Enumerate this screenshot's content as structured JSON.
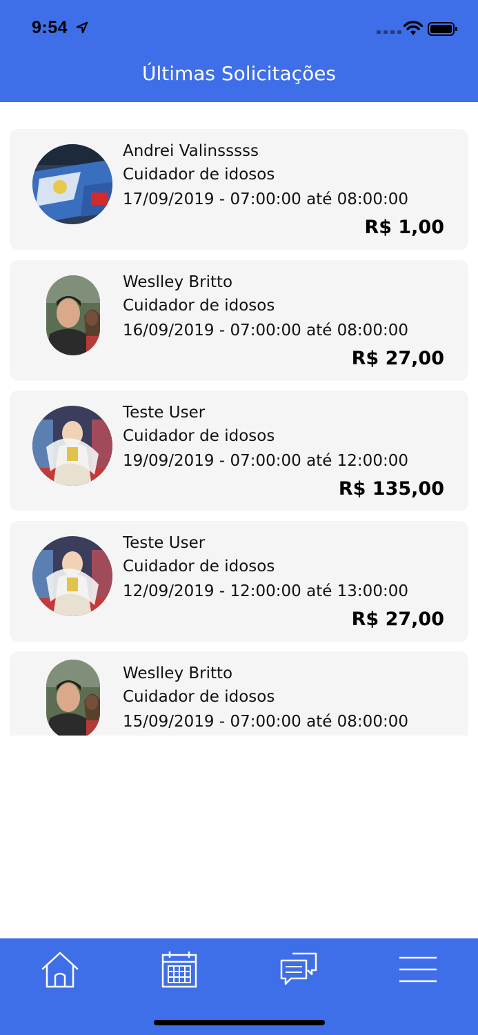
{
  "status_bar": {
    "time": "9:54"
  },
  "header": {
    "title": "Últimas Solicitações"
  },
  "requests": [
    {
      "name": "Andrei Valinsssss",
      "service": "Cuidador de idosos",
      "date": "17/09/2019 - 07:00:00 até 08:00:00",
      "price": "R$ 1,00"
    },
    {
      "name": "Weslley Britto",
      "service": "Cuidador de idosos",
      "date": "16/09/2019 - 07:00:00 até 08:00:00",
      "price": "R$ 27,00"
    },
    {
      "name": "Teste User",
      "service": "Cuidador de idosos",
      "date": "19/09/2019 - 07:00:00 até 12:00:00",
      "price": "R$ 135,00"
    },
    {
      "name": "Teste User",
      "service": "Cuidador de idosos",
      "date": "12/09/2019 - 12:00:00 até 13:00:00",
      "price": "R$ 27,00"
    },
    {
      "name": "Weslley Britto",
      "service": "Cuidador de idosos",
      "date": "15/09/2019 - 07:00:00 até 08:00:00",
      "price": ""
    }
  ],
  "tab_bar": {
    "items": [
      {
        "icon": "home-icon"
      },
      {
        "icon": "calendar-icon"
      },
      {
        "icon": "chat-icon"
      },
      {
        "icon": "menu-icon"
      }
    ]
  },
  "colors": {
    "primary": "#3E6FE8",
    "card": "#F5F5F6",
    "text": "#111111"
  }
}
